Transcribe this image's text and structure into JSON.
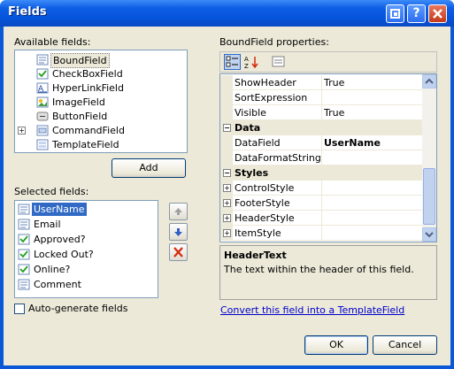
{
  "window": {
    "title": "Fields"
  },
  "available": {
    "label": "Available fields:",
    "items": [
      {
        "label": "BoundField",
        "icon": "bound-field-icon"
      },
      {
        "label": "CheckBoxField",
        "icon": "checkbox-field-icon"
      },
      {
        "label": "HyperLinkField",
        "icon": "hyperlink-field-icon"
      },
      {
        "label": "ImageField",
        "icon": "image-field-icon"
      },
      {
        "label": "ButtonField",
        "icon": "button-field-icon"
      },
      {
        "label": "CommandField",
        "icon": "command-field-icon"
      },
      {
        "label": "TemplateField",
        "icon": "template-field-icon"
      }
    ],
    "selected_item": "BoundField"
  },
  "add_button": "Add",
  "selected": {
    "label": "Selected fields:",
    "items": [
      {
        "label": "UserName",
        "icon": "bound-field-icon"
      },
      {
        "label": "Email",
        "icon": "bound-field-icon"
      },
      {
        "label": "Approved?",
        "icon": "checkbox-field-icon"
      },
      {
        "label": "Locked Out?",
        "icon": "checkbox-field-icon"
      },
      {
        "label": "Online?",
        "icon": "checkbox-field-icon"
      },
      {
        "label": "Comment",
        "icon": "bound-field-icon"
      }
    ],
    "selected_item": "UserName"
  },
  "autogen": {
    "label": "Auto-generate fields",
    "checked": false
  },
  "properties": {
    "label": "BoundField properties:",
    "rows": [
      {
        "type": "prop",
        "name": "ShowHeader",
        "value": "True"
      },
      {
        "type": "prop",
        "name": "SortExpression",
        "value": ""
      },
      {
        "type": "prop",
        "name": "Visible",
        "value": "True"
      },
      {
        "type": "category",
        "name": "Data",
        "expanded": true
      },
      {
        "type": "prop",
        "name": "DataField",
        "value": "UserName",
        "bold": true
      },
      {
        "type": "prop",
        "name": "DataFormatString",
        "value": ""
      },
      {
        "type": "category",
        "name": "Styles",
        "expanded": true
      },
      {
        "type": "prop",
        "name": "ControlStyle",
        "value": "",
        "expandable": true
      },
      {
        "type": "prop",
        "name": "FooterStyle",
        "value": "",
        "expandable": true
      },
      {
        "type": "prop",
        "name": "HeaderStyle",
        "value": "",
        "expandable": true
      },
      {
        "type": "prop",
        "name": "ItemStyle",
        "value": "",
        "expandable": true
      }
    ]
  },
  "description": {
    "title": "HeaderText",
    "text": "The text within the header of this field."
  },
  "convert_link": "Convert this field into a TemplateField",
  "ok_button": "OK",
  "cancel_button": "Cancel",
  "colors": {
    "titlebar": "#0553d9",
    "selection": "#316ac5",
    "dialog_bg": "#ece9d8"
  }
}
